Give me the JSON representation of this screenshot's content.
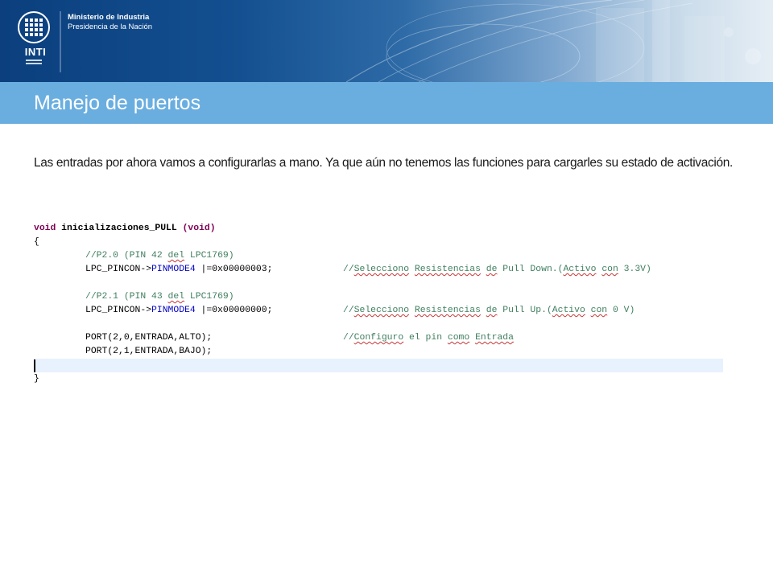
{
  "header": {
    "logo_text": "INTI",
    "ministry_line1": "Ministerio de Industria",
    "ministry_line2": "Presidencia de la Nación"
  },
  "slide": {
    "title": "Manejo de puertos",
    "paragraph": "Las entradas por ahora vamos a configurarlas a mano. Ya que aún no tenemos las funciones para cargarles su estado de activación."
  },
  "code": {
    "decl_ret": "void",
    "decl_name": " inicializaciones_PULL ",
    "decl_param": "(void)",
    "brace_open": "{",
    "c1_pre": "//P2.0 (PIN 42 ",
    "c1_sq": "del",
    "c1_post": " LPC1769)",
    "s1_pre": "LPC_PINCON->",
    "s1_field": "PINMODE4",
    "s1_post": " |=0x00000003;",
    "r1_a": "//",
    "r1_b": "Selecciono",
    "r1_c": " ",
    "r1_d": "Resistencias",
    "r1_e": " ",
    "r1_f": "de",
    "r1_g": " Pull Down.(",
    "r1_h": "Activo",
    "r1_i": " ",
    "r1_j": "con",
    "r1_k": " 3.3V)",
    "c2_pre": "//P2.1 (PIN 43 ",
    "c2_sq": "del",
    "c2_post": " LPC1769)",
    "s2_pre": "LPC_PINCON->",
    "s2_field": "PINMODE4",
    "s2_post": " |=0x00000000;",
    "r2_a": "//",
    "r2_b": "Selecciono",
    "r2_c": " ",
    "r2_d": "Resistencias",
    "r2_e": " ",
    "r2_f": "de",
    "r2_g": " Pull Up.(",
    "r2_h": "Activo",
    "r2_i": " ",
    "r2_j": "con",
    "r2_k": " 0 V)",
    "p1": "PORT(2,0,ENTRADA,ALTO);",
    "r3_a": "//",
    "r3_b": "Configuro",
    "r3_c": " el pin ",
    "r3_d": "como",
    "r3_e": " ",
    "r3_f": "Entrada",
    "p2": "PORT(2,1,ENTRADA,BAJO);",
    "brace_close": "}"
  },
  "colors": {
    "title_bar": "#6aaee0",
    "keyword": "#7f0055",
    "comment": "#3f7f5f",
    "field": "#0000c0",
    "current_line": "#e8f2fe"
  }
}
